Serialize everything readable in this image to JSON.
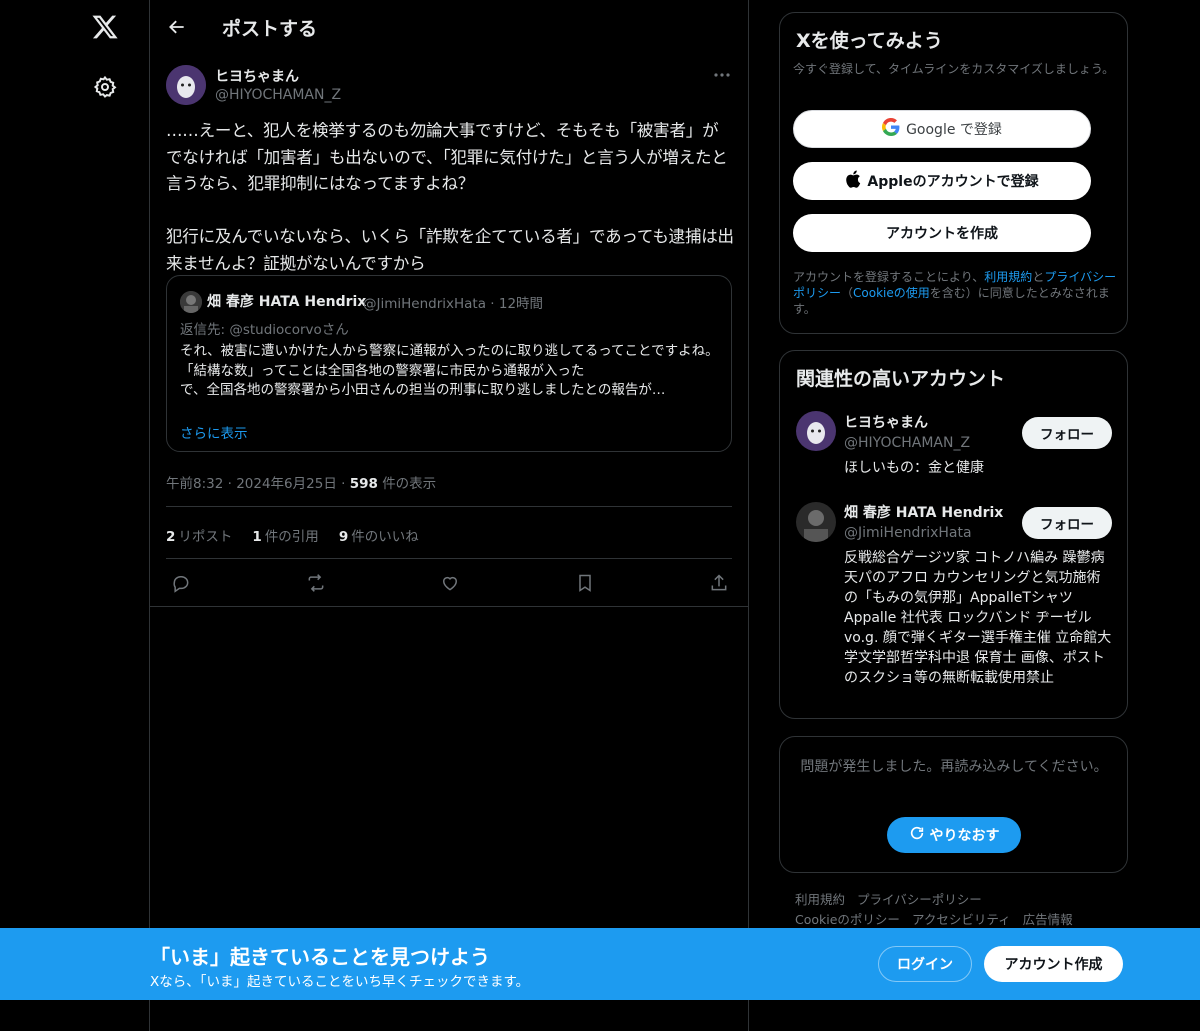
{
  "header": {
    "title": "ポストする"
  },
  "post": {
    "author_name": "ヒヨちゃまん",
    "author_handle": "@HIYOCHAMAN_Z",
    "text": "……えーと、犯人を検挙するのも勿論大事ですけど、そもそも「被害者」がでなければ「加害者」も出ないので、「犯罪に気付けた」と言う人が増えたと言うなら、犯罪抑制にはなってますよね？\n\n犯行に及んでいないなら、いくら「詐欺を企てている者」であっても逮捕は出来ませんよ？証拠がないんですから",
    "time": "午前8:32",
    "date": "2024年6月25日",
    "views_count": "598",
    "views_label": "件の表示",
    "reposts_count": "2",
    "reposts_label": "リポスト",
    "quotes_count": "1",
    "quotes_label": "件の引用",
    "likes_count": "9",
    "likes_label": "件のいいね"
  },
  "quote": {
    "name": "畑 春彦 HATA Hendrix",
    "handle": "@JimiHendrixHata · 12時間",
    "reply_to": "返信先: @studiocorvoさん",
    "text": "それ、被害に遭いかけた人から警察に通報が入ったのに取り逃してるってことですよね。\n「結構な数」ってことは全国各地の警察署に市民から通報が入った\nで、全国各地の警察署から小田さんの担当の刑事に取り逃しましたとの報告が…",
    "show_more": "さらに表示"
  },
  "signup": {
    "title": "Xを使ってみよう",
    "subtitle": "今すぐ登録して、タイムラインをカスタマイズしましょう。",
    "google_label": "Google で登録",
    "apple_label": "Appleのアカウントで登録",
    "create_label": "アカウントを作成",
    "terms_1": "アカウントを登録することにより、",
    "terms_link1": "利用規約",
    "terms_2": "と",
    "terms_link2": "プライバシーポリシー",
    "terms_3": "（",
    "terms_link3": "Cookieの使用",
    "terms_4": "を含む）に同意したとみなされます。"
  },
  "related": {
    "title": "関連性の高いアカウント",
    "follow_label": "フォロー",
    "accounts": [
      {
        "name": "ヒヨちゃまん",
        "handle": "@HIYOCHAMAN_Z",
        "bio": "ほしいもの：金と健康"
      },
      {
        "name": "畑 春彦 HATA Hendrix",
        "handle": "@JimiHendrixHata",
        "bio": "反戦総合ゲージツ家 コトノハ編み 躁鬱病 天パのアフロ カウンセリングと気功施術の「もみの気伊那」AppalleTシャツAppalle 社代表 ロックバンド ヂーゼルvo.g. 顔で弾くギター選手権主催 立命館大学文学部哲学科中退 保育士 画像、ポストのスクショ等の無断転載使用禁止"
      }
    ]
  },
  "error": {
    "message": "問題が発生しました。再読み込みしてください。",
    "retry_label": "やりなおす"
  },
  "footer": {
    "links": [
      "利用規約",
      "プライバシーポリシー",
      "Cookieのポリシー",
      "アクセシビリティ",
      "広告情報"
    ]
  },
  "bottom_bar": {
    "title": "「いま」起きていることを見つけよう",
    "subtitle": "Xなら、「いま」起きていることをいち早くチェックできます。",
    "login_label": "ログイン",
    "create_label": "アカウント作成"
  },
  "colors": {
    "accent": "#1d9bf0",
    "background": "#000000",
    "border": "#2f3336",
    "muted": "#71767b"
  },
  "icons": [
    "x-logo-icon",
    "settings-icon",
    "back-arrow-icon",
    "more-icon",
    "reply-icon",
    "repost-icon",
    "like-icon",
    "bookmark-icon",
    "share-icon",
    "google-icon",
    "apple-icon",
    "refresh-icon"
  ]
}
